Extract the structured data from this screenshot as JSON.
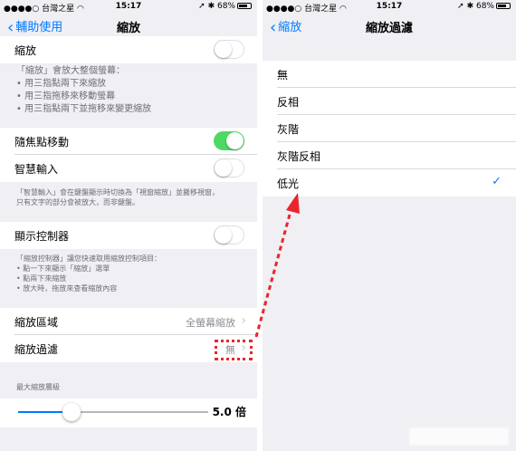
{
  "status_bar": {
    "carrier": "台灣之星",
    "time": "15:17",
    "battery": "68%"
  },
  "left": {
    "nav": {
      "back_label": "輔助使用",
      "title": "縮放"
    },
    "zoom_row": {
      "label": "縮放",
      "toggle_on": false
    },
    "zoom_footer": {
      "title": "「縮放」會放大整個螢幕：",
      "bullets": [
        "用三指點兩下來縮放",
        "用三指拖移來移動螢幕",
        "用三指點兩下並拖移來變更縮放"
      ]
    },
    "follow_focus": {
      "label": "隨焦點移動",
      "toggle_on": true
    },
    "smart_typing": {
      "label": "智慧輸入",
      "toggle_on": false
    },
    "smart_footer": {
      "line1": "「智慧輸入」會在鍵盤顯示時切換為「視窗縮放」並搬移視窗，",
      "line2": "只有文字的部分會被放大，而非鍵盤。"
    },
    "controller": {
      "label": "顯示控制器",
      "toggle_on": false
    },
    "controller_footer": {
      "title": "「縮放控制器」讓您快速取用縮放控制項目：",
      "bullets": [
        "點一下來顯示「縮放」選單",
        "點兩下來縮放",
        "放大時，拖放來查看縮放內容"
      ]
    },
    "zoom_region": {
      "label": "縮放區域",
      "value": "全螢幕縮放"
    },
    "zoom_filter": {
      "label": "縮放過濾",
      "value": "無"
    },
    "max_zoom": {
      "header": "最大縮放層級",
      "value_text": "5.0 倍",
      "fraction": 0.28
    }
  },
  "right": {
    "nav": {
      "back_label": "縮放",
      "title": "縮放過濾"
    },
    "options": [
      {
        "label": "無",
        "selected": false
      },
      {
        "label": "反相",
        "selected": false
      },
      {
        "label": "灰階",
        "selected": false
      },
      {
        "label": "灰階反相",
        "selected": false
      },
      {
        "label": "低光",
        "selected": true
      }
    ]
  },
  "icons": {
    "back": "chevron-left-icon",
    "disclosure": "chevron-right-icon",
    "check": "checkmark-icon"
  },
  "colors": {
    "accent": "#007aff",
    "toggle_on": "#4cd964",
    "annotation": "#e8262b",
    "grouped_bg": "#efeff4"
  }
}
